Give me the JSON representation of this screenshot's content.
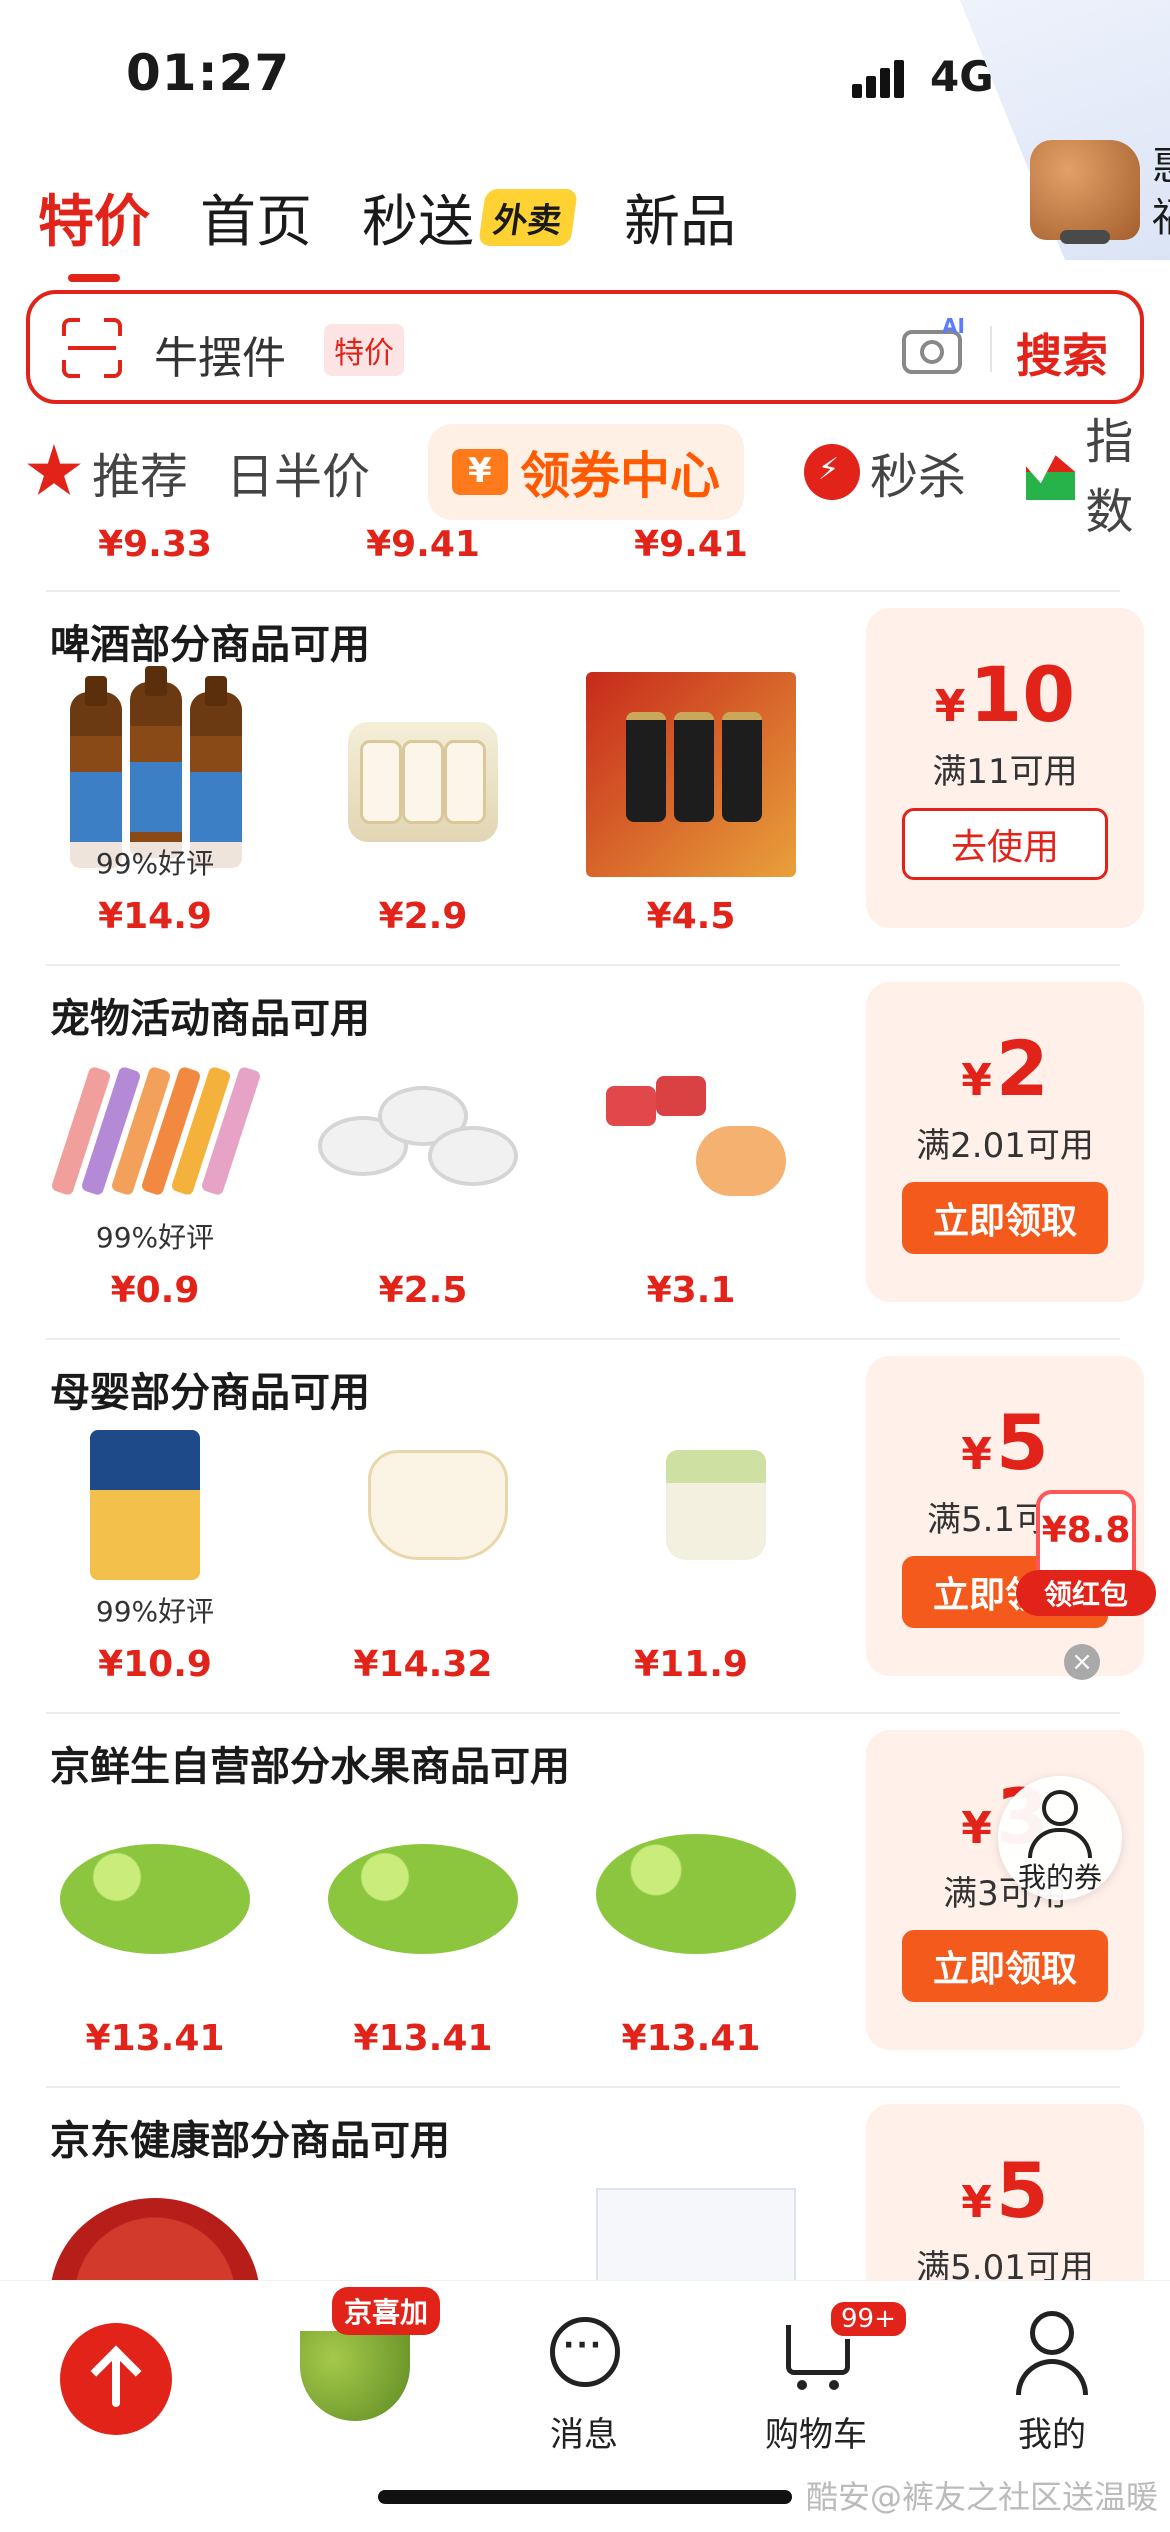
{
  "status_bar": {
    "time": "01:27",
    "network": "4G"
  },
  "corner_ad": {
    "text": "惠 福"
  },
  "top_tabs": [
    {
      "label": "特价",
      "active": true
    },
    {
      "label": "首页"
    },
    {
      "label": "秒送",
      "badge": "外卖"
    },
    {
      "label": "新品"
    }
  ],
  "search": {
    "query": "牛摆件",
    "tag": "特价",
    "button": "搜索"
  },
  "categories": {
    "recommend": "推荐",
    "half_price": "日半价",
    "coupon_center": "领券中心",
    "flash_sale": "秒杀",
    "index": "指数"
  },
  "partial_row": {
    "prices": [
      "¥9.33",
      "¥9.41",
      "¥9.41"
    ]
  },
  "sections": [
    {
      "title": "啤酒部分商品可用",
      "products": [
        {
          "price": "¥14.9",
          "rating": "99%好评"
        },
        {
          "price": "¥2.9"
        },
        {
          "price": "¥4.5"
        }
      ],
      "coupon": {
        "amount": "10",
        "condition": "满11可用",
        "button": "去使用"
      }
    },
    {
      "title": "宠物活动商品可用",
      "products": [
        {
          "price": "¥0.9",
          "rating": "99%好评"
        },
        {
          "price": "¥2.5"
        },
        {
          "price": "¥3.1"
        }
      ],
      "coupon": {
        "amount": "2",
        "condition": "满2.01可用",
        "button": "立即领取"
      }
    },
    {
      "title": "母婴部分商品可用",
      "products": [
        {
          "price": "¥10.9",
          "rating": "99%好评"
        },
        {
          "price": "¥14.32"
        },
        {
          "price": "¥11.9"
        }
      ],
      "coupon": {
        "amount": "5",
        "condition": "满5.1可用",
        "button": "立即领取"
      }
    },
    {
      "title": "京鲜生自营部分水果商品可用",
      "products": [
        {
          "price": "¥13.41"
        },
        {
          "price": "¥13.41"
        },
        {
          "price": "¥13.41"
        }
      ],
      "coupon": {
        "amount": "3",
        "condition": "满3可用",
        "button": "立即领取"
      }
    },
    {
      "title": "京东健康部分商品可用",
      "products": [
        {
          "price": ""
        },
        {
          "price": ""
        },
        {
          "price": ""
        }
      ],
      "coupon": {
        "amount": "5",
        "condition": "满5.01可用",
        "button": ""
      }
    }
  ],
  "floating": {
    "red_packet_amount": "¥8.8",
    "red_packet_label": "领红包",
    "my_coupon": "我的券"
  },
  "bottom_nav": {
    "jingxijia_badge": "京喜加",
    "message": "消息",
    "cart": "购物车",
    "cart_badge": "99+",
    "me": "我的"
  },
  "watermark": "酷安@裤友之社区送温暖",
  "colors": {
    "accent": "#e2231a",
    "orange": "#f55a1d",
    "coupon_bg": "#fff0ea"
  }
}
